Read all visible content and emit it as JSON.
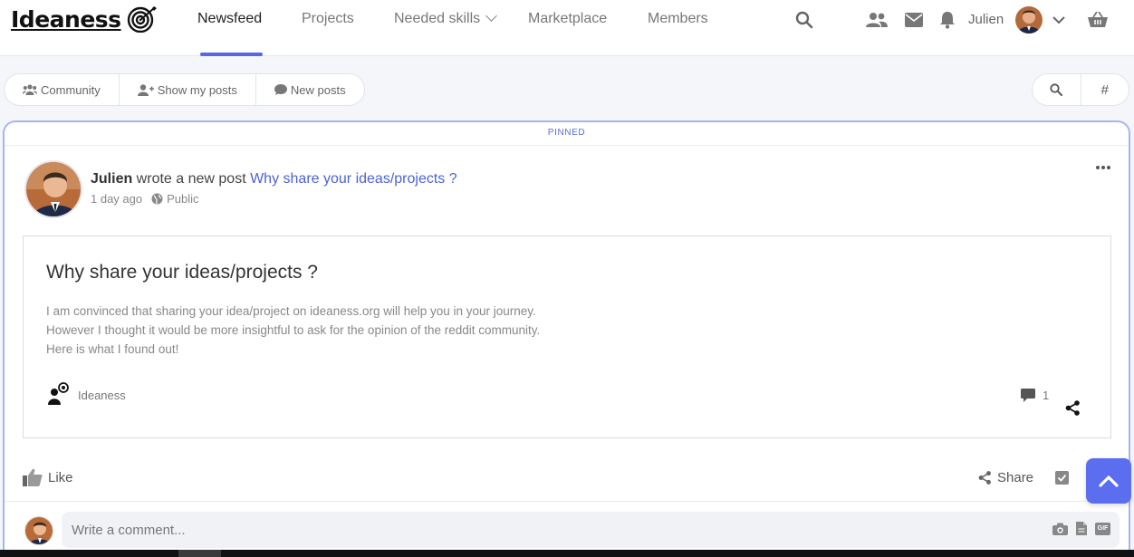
{
  "brand": {
    "name": "Ideaness",
    "icon": "target-icon"
  },
  "nav": {
    "items": [
      {
        "label": "Newsfeed",
        "active": true
      },
      {
        "label": "Projects"
      },
      {
        "label": "Needed skills"
      },
      {
        "label": "Marketplace"
      },
      {
        "label": "Members"
      }
    ],
    "user_name": "Julien"
  },
  "filters": {
    "items": [
      {
        "label": "Community",
        "icon": "users-icon"
      },
      {
        "label": "Show my posts",
        "icon": "user-plus-icon"
      },
      {
        "label": "New posts",
        "icon": "chat-icon"
      }
    ],
    "hash": "#"
  },
  "post": {
    "pinned_label": "PINNED",
    "author": "Julien",
    "action": " wrote a new post ",
    "link": "Why share your ideas/projects ?",
    "time": "1 day ago",
    "visibility": "Public",
    "title": "Why share your ideas/projects ?",
    "body": [
      "I am convinced that sharing your idea/project on ideaness.org will help you in your journey.",
      "However I thought it would be more insightful to ask for the opinion of the reddit community.",
      "Here is what I found out!"
    ],
    "group": "Ideaness",
    "comment_count": "1"
  },
  "actions": {
    "like": "Like",
    "share": "Share"
  },
  "comment": {
    "placeholder": "Write a comment..."
  },
  "colors": {
    "accent": "#5468e7",
    "link": "#4b63d6",
    "pinned_border": "#a9b4ef"
  }
}
